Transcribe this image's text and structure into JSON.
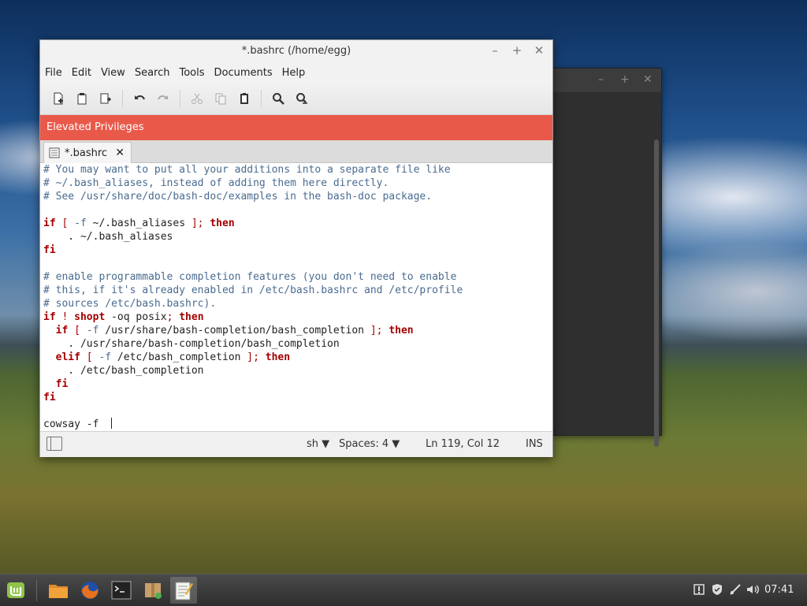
{
  "background_window": {
    "controls": [
      "–",
      "+",
      "✕"
    ]
  },
  "window": {
    "title": "*.bashrc (/home/egg)",
    "controls": {
      "minimize": "–",
      "maximize": "+",
      "close": "✕"
    }
  },
  "menubar": {
    "items": [
      "File",
      "Edit",
      "View",
      "Search",
      "Tools",
      "Documents",
      "Help"
    ]
  },
  "toolbar": {
    "buttons": [
      {
        "icon": "new-document-icon",
        "enabled": true
      },
      {
        "icon": "open-document-icon",
        "enabled": true
      },
      {
        "icon": "save-document-icon",
        "enabled": true
      },
      {
        "icon": "undo-icon",
        "enabled": true
      },
      {
        "icon": "redo-icon",
        "enabled": false
      },
      {
        "icon": "cut-icon",
        "enabled": false
      },
      {
        "icon": "copy-icon",
        "enabled": false
      },
      {
        "icon": "paste-icon",
        "enabled": true
      },
      {
        "icon": "find-icon",
        "enabled": true
      },
      {
        "icon": "find-replace-icon",
        "enabled": true
      }
    ]
  },
  "banner": {
    "text": "Elevated Privileges",
    "color": "#e9594a"
  },
  "tab": {
    "label": "*.bashrc",
    "close": "✕"
  },
  "editor": {
    "lines": [
      [
        {
          "t": "# You may want to put all your additions into a separate file like",
          "c": "comment"
        }
      ],
      [
        {
          "t": "# ~/.bash_aliases, instead of adding them here directly.",
          "c": "comment"
        }
      ],
      [
        {
          "t": "# See /usr/share/doc/bash-doc/examples in the bash-doc package.",
          "c": "comment"
        }
      ],
      [],
      [
        {
          "t": "if",
          "c": "kw"
        },
        {
          "t": " ",
          "c": ""
        },
        {
          "t": "[",
          "c": "op"
        },
        {
          "t": " ",
          "c": ""
        },
        {
          "t": "-f",
          "c": "flag"
        },
        {
          "t": " ~/.bash_aliases ",
          "c": ""
        },
        {
          "t": "];",
          "c": "op"
        },
        {
          "t": " ",
          "c": ""
        },
        {
          "t": "then",
          "c": "kw"
        }
      ],
      [
        {
          "t": "    . ~/.bash_aliases",
          "c": ""
        }
      ],
      [
        {
          "t": "fi",
          "c": "kw"
        }
      ],
      [],
      [
        {
          "t": "# enable programmable completion features (you don't need to enable",
          "c": "comment"
        }
      ],
      [
        {
          "t": "# this, if it's already enabled in /etc/bash.bashrc and /etc/profile",
          "c": "comment"
        }
      ],
      [
        {
          "t": "# sources /etc/bash.bashrc).",
          "c": "comment"
        }
      ],
      [
        {
          "t": "if",
          "c": "kw"
        },
        {
          "t": " ",
          "c": ""
        },
        {
          "t": "!",
          "c": "op"
        },
        {
          "t": " ",
          "c": ""
        },
        {
          "t": "shopt",
          "c": "kw"
        },
        {
          "t": " -oq posix",
          "c": ""
        },
        {
          "t": ";",
          "c": "op"
        },
        {
          "t": " ",
          "c": ""
        },
        {
          "t": "then",
          "c": "kw"
        }
      ],
      [
        {
          "t": "  ",
          "c": ""
        },
        {
          "t": "if",
          "c": "kw"
        },
        {
          "t": " ",
          "c": ""
        },
        {
          "t": "[",
          "c": "op"
        },
        {
          "t": " ",
          "c": ""
        },
        {
          "t": "-f",
          "c": "flag"
        },
        {
          "t": " /usr/share/bash-completion/bash_completion ",
          "c": ""
        },
        {
          "t": "];",
          "c": "op"
        },
        {
          "t": " ",
          "c": ""
        },
        {
          "t": "then",
          "c": "kw"
        }
      ],
      [
        {
          "t": "    . /usr/share/bash-completion/bash_completion",
          "c": ""
        }
      ],
      [
        {
          "t": "  ",
          "c": ""
        },
        {
          "t": "elif",
          "c": "kw"
        },
        {
          "t": " ",
          "c": ""
        },
        {
          "t": "[",
          "c": "op"
        },
        {
          "t": " ",
          "c": ""
        },
        {
          "t": "-f",
          "c": "flag"
        },
        {
          "t": " /etc/bash_completion ",
          "c": ""
        },
        {
          "t": "];",
          "c": "op"
        },
        {
          "t": " ",
          "c": ""
        },
        {
          "t": "then",
          "c": "kw"
        }
      ],
      [
        {
          "t": "    . /etc/bash_completion",
          "c": ""
        }
      ],
      [
        {
          "t": "  ",
          "c": ""
        },
        {
          "t": "fi",
          "c": "kw"
        }
      ],
      [
        {
          "t": "fi",
          "c": "kw"
        }
      ],
      [],
      [
        {
          "t": "cowsay -f  ",
          "c": ""
        }
      ]
    ],
    "caret_line": 19
  },
  "statusbar": {
    "language": "sh ▼",
    "spaces": "Spaces: 4 ▼",
    "position": "Ln 119, Col 12",
    "mode": "INS"
  },
  "taskbar": {
    "launchers": [
      {
        "name": "menu-button",
        "icon": "mint-logo-icon"
      },
      {
        "name": "files-launcher",
        "icon": "folder-icon"
      },
      {
        "name": "firefox-launcher",
        "icon": "firefox-icon"
      },
      {
        "name": "terminal-launcher",
        "icon": "terminal-icon"
      },
      {
        "name": "software-launcher",
        "icon": "package-icon"
      },
      {
        "name": "text-editor-launcher",
        "icon": "text-editor-icon",
        "active": true
      }
    ],
    "tray": [
      "update-manager-icon",
      "shield-icon",
      "network-icon",
      "volume-icon"
    ],
    "clock": "07:41"
  }
}
